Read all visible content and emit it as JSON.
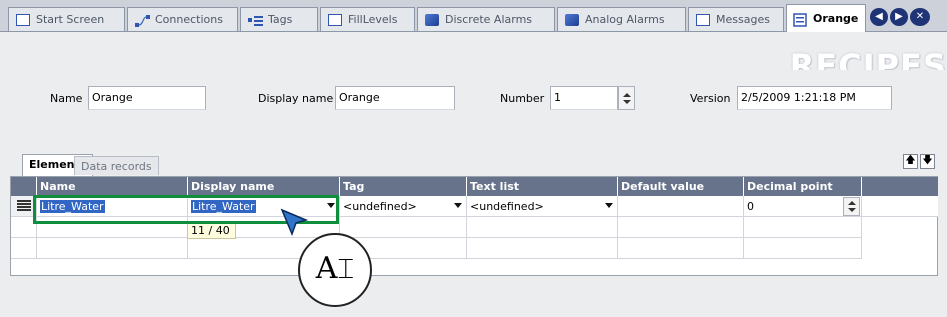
{
  "tabs": [
    {
      "label": "Start Screen",
      "icon": "screen-icon"
    },
    {
      "label": "Connections",
      "icon": "connections-icon"
    },
    {
      "label": "Tags",
      "icon": "tags-icon"
    },
    {
      "label": "FillLevels",
      "icon": "screen-icon"
    },
    {
      "label": "Discrete Alarms",
      "icon": "discrete-alarms-icon"
    },
    {
      "label": "Analog Alarms",
      "icon": "analog-alarms-icon"
    },
    {
      "label": "Messages",
      "icon": "screen-icon"
    },
    {
      "label": "Orange",
      "icon": "recipe-icon",
      "active": true
    }
  ],
  "nav_buttons": [
    "previous-tab",
    "next-tab",
    "close-tab"
  ],
  "header": {
    "title": "RECIPES"
  },
  "recipe_fields": {
    "name_label": "Name",
    "name_value": "Orange",
    "display_name_label": "Display name",
    "display_name_value": "Orange",
    "number_label": "Number",
    "number_value": "1",
    "version_label": "Version",
    "version_value": "2/5/2009 1:21:18 PM"
  },
  "inner_tabs": [
    {
      "label": "Elements",
      "active": true
    },
    {
      "label": "Data records",
      "active": false
    }
  ],
  "grid": {
    "columns": [
      "Name",
      "Display name",
      "Tag",
      "Text list",
      "Default value",
      "Decimal point"
    ],
    "rows": [
      {
        "name": "Litre_Water",
        "display_name": "Litre_Water",
        "tag": "<undefined>",
        "text_list": "<undefined>",
        "default_value": "",
        "decimal_point": "0"
      }
    ],
    "char_counter": "11 / 40"
  },
  "callout": {
    "text": "A"
  },
  "colors": {
    "header_bg": "#66738a",
    "highlight": "#0f8f3d",
    "selection": "#3166c5",
    "nav_button": "#1f3476"
  }
}
